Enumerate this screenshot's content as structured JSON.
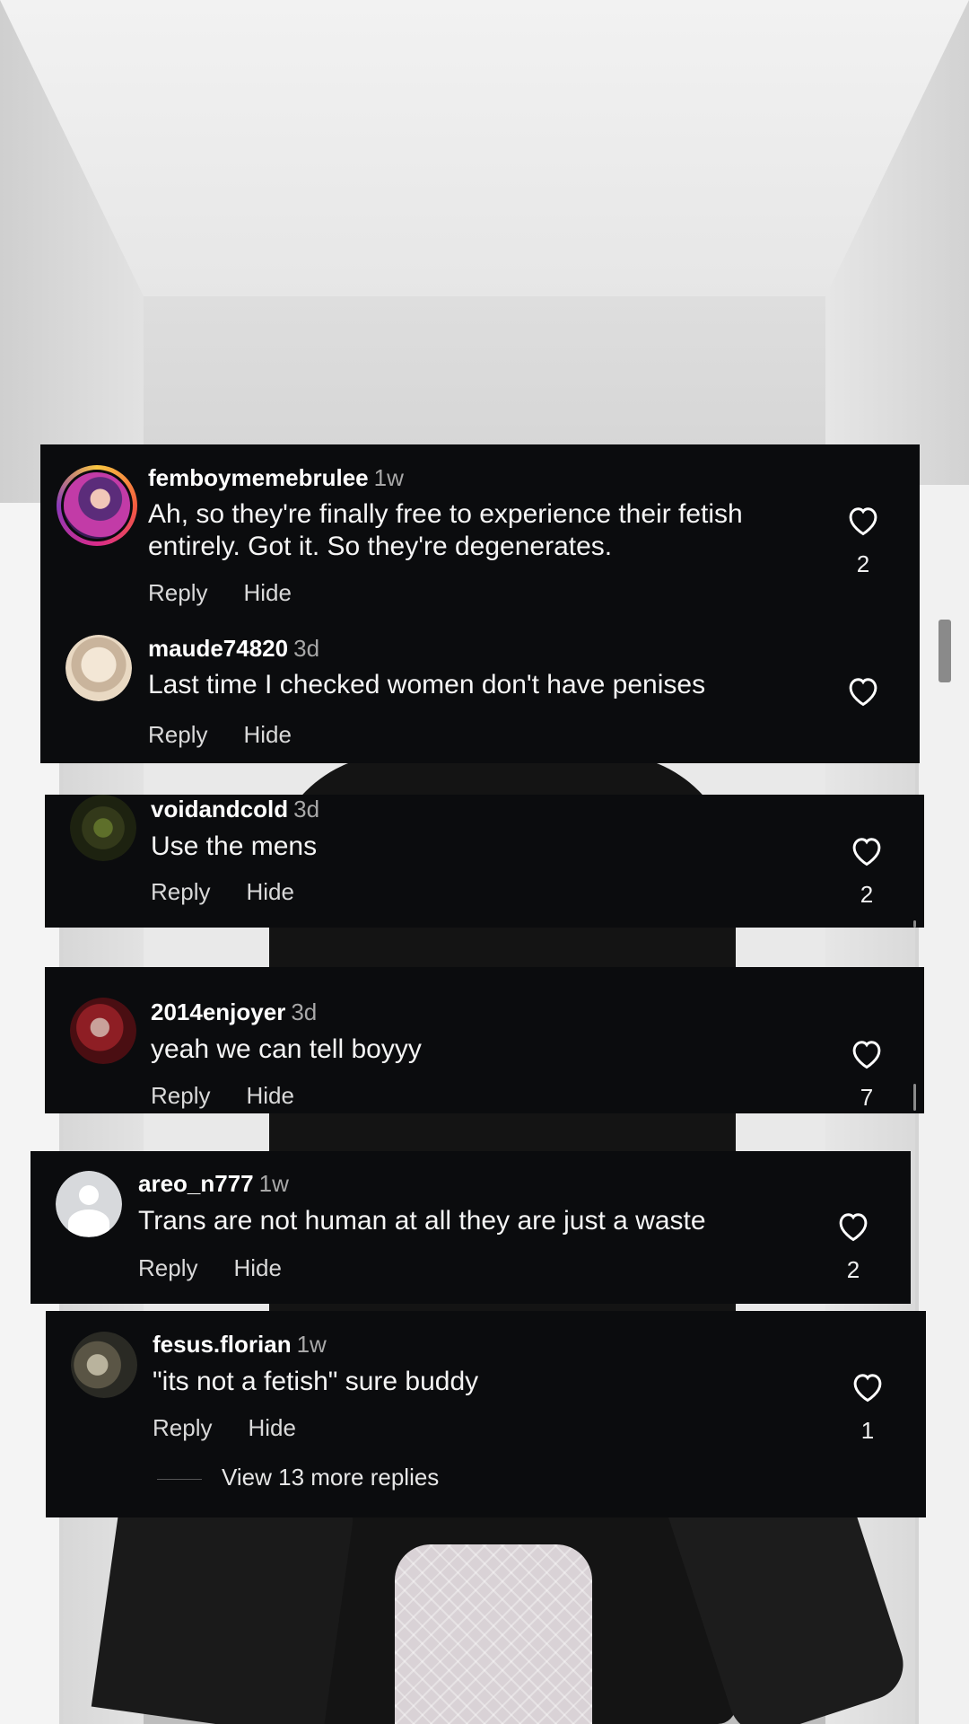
{
  "comments": [
    {
      "username": "femboymemebrulee",
      "time": "1w",
      "text": "Ah, so they're finally free to experience their fetish entirely. Got it. So they're degenerates.",
      "reply": "Reply",
      "hide": "Hide",
      "likes": "2",
      "avatar_icon": "profile-ring-avatar"
    },
    {
      "username": "maude74820",
      "time": "3d",
      "text": "Last time I checked women don't have penises",
      "reply": "Reply",
      "hide": "Hide",
      "likes": "",
      "avatar_icon": "sketch-avatar"
    },
    {
      "username": "voidandcold",
      "time": "3d",
      "text": "Use the mens",
      "reply": "Reply",
      "hide": "Hide",
      "likes": "2",
      "avatar_icon": "creature-avatar"
    },
    {
      "username": "2014enjoyer",
      "time": "3d",
      "text": "yeah we can tell boyyy",
      "reply": "Reply",
      "hide": "Hide",
      "likes": "7",
      "avatar_icon": "red-hair-avatar"
    },
    {
      "username": "areo_n777",
      "time": "1w",
      "text": "Trans are not human at all they are just a waste",
      "reply": "Reply",
      "hide": "Hide",
      "likes": "2",
      "avatar_icon": "default-avatar"
    },
    {
      "username": "fesus.florian",
      "time": "1w",
      "text": "\"its not a fetish\" sure buddy",
      "reply": "Reply",
      "hide": "Hide",
      "likes": "1",
      "avatar_icon": "cat-avatar"
    }
  ],
  "view_more": "View 13 more replies",
  "colors": {
    "card_bg": "#0b0c0e",
    "text": "#ffffff",
    "secondary": "#a8a8a8"
  }
}
